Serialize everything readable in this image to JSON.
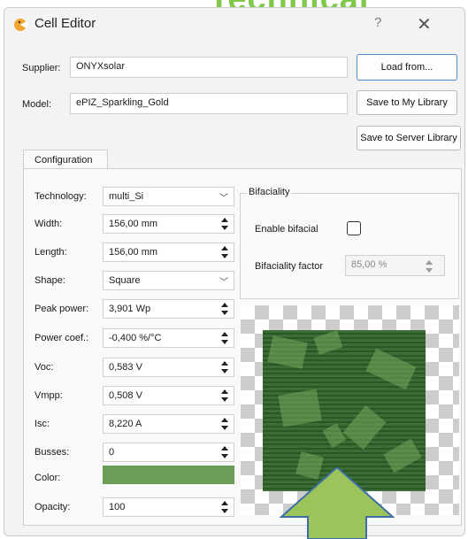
{
  "background": {
    "partial_title": "Technical"
  },
  "window": {
    "title": "Cell Editor",
    "help": "?",
    "close": "✕"
  },
  "header": {
    "supplier_label": "Supplier:",
    "supplier_value": "ONYXsolar",
    "model_label": "Model:",
    "model_value": "ePIZ_Sparkling_Gold"
  },
  "buttons": {
    "load_from": "Load from...",
    "save_my_library": "Save to My Library",
    "save_server_library": "Save to Server Library"
  },
  "tabs": {
    "configuration": "Configuration"
  },
  "config": {
    "technology_label": "Technology:",
    "technology_value": "multi_Si",
    "width_label": "Width:",
    "width_value": "156,00 mm",
    "length_label": "Length:",
    "length_value": "156,00 mm",
    "shape_label": "Shape:",
    "shape_value": "Square",
    "peak_power_label": "Peak power:",
    "peak_power_value": "3,901 Wp",
    "power_coef_label": "Power coef.:",
    "power_coef_value": "-0,400 %/°C",
    "voc_label": "Voc:",
    "voc_value": "0,583 V",
    "vmpp_label": "Vmpp:",
    "vmpp_value": "0,508 V",
    "isc_label": "Isc:",
    "isc_value": "8,220 A",
    "busses_label": "Busses:",
    "busses_value": "0",
    "color_label": "Color:",
    "color_hex": "#6a9e56",
    "opacity_label": "Opacity:",
    "opacity_value": "100"
  },
  "bifaciality": {
    "group_title": "Bifaciality",
    "enable_label": "Enable bifacial",
    "enabled": false,
    "factor_label": "Bifaciality factor",
    "factor_value": "85,00 %"
  },
  "colors": {
    "accent_blue": "#4a8fd6",
    "cell_green": "#3a6e34",
    "arrow_green": "#9cc45a"
  }
}
